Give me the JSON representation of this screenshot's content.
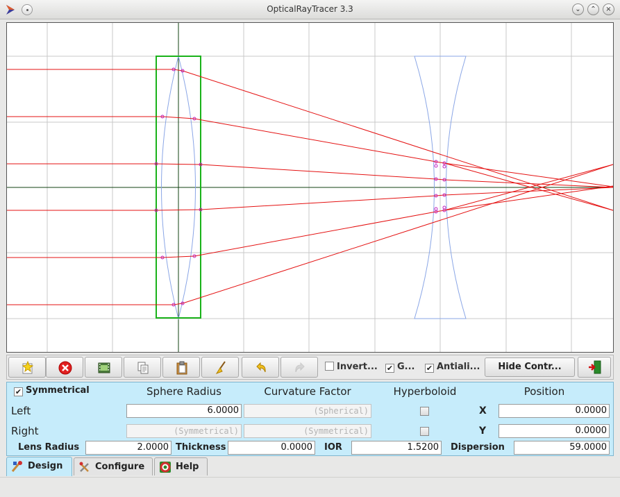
{
  "window": {
    "title": "OpticalRayTracer 3.3"
  },
  "toolbar": {
    "buttons": [
      {
        "name": "new-lens-button",
        "icon": "star-sparkle-icon"
      },
      {
        "name": "delete-lens-button",
        "icon": "red-x-icon"
      },
      {
        "name": "film-strip-button",
        "icon": "film-strip-icon"
      },
      {
        "name": "copy-button",
        "icon": "copy-icon"
      },
      {
        "name": "paste-button",
        "icon": "clipboard-icon"
      },
      {
        "name": "clean-button",
        "icon": "broom-icon"
      },
      {
        "name": "undo-button",
        "icon": "undo-arrow-icon"
      },
      {
        "name": "redo-button",
        "icon": "redo-arrow-icon",
        "disabled": true
      }
    ],
    "invert_label": "Invert...",
    "invert_checked": false,
    "grid_label": "G...",
    "grid_checked": true,
    "antialias_label": "Antiali...",
    "antialias_checked": true,
    "hide_controls_label": "Hide Contr...",
    "exit_icon": "exit-door-icon"
  },
  "controls": {
    "symmetrical_label": "Symmetrical",
    "symmetrical_checked": true,
    "headers": {
      "sphere_radius": "Sphere Radius",
      "curvature_factor": "Curvature Factor",
      "hyperboloid": "Hyperboloid",
      "position": "Position"
    },
    "left_label": "Left",
    "right_label": "Right",
    "left_sphere_radius": "6.0000",
    "left_curvature_placeholder": "(Spherical)",
    "right_sphere_radius_placeholder": "(Symmetrical)",
    "right_curvature_placeholder": "(Symmetrical)",
    "left_hyperboloid": false,
    "right_hyperboloid": false,
    "x_label": "X",
    "x_value": "0.0000",
    "y_label": "Y",
    "y_value": "0.0000",
    "lens_radius_label": "Lens Radius",
    "lens_radius_value": "2.0000",
    "thickness_label": "Thickness",
    "thickness_value": "0.0000",
    "ior_label": "IOR",
    "ior_value": "1.5200",
    "dispersion_label": "Dispersion",
    "dispersion_value": "59.0000"
  },
  "tabs": [
    {
      "label": "Design",
      "icon": "design-tools-icon",
      "active": true
    },
    {
      "label": "Configure",
      "icon": "configure-tools-icon",
      "active": false
    },
    {
      "label": "Help",
      "icon": "help-lifebuoy-icon",
      "active": false
    }
  ],
  "colors": {
    "ray": "#e41010",
    "lens_outline": "#8aa6e6",
    "selected_lens": "#19b219",
    "grid": "#c8c8c8",
    "axis": "#104010",
    "control_panel": "#c6ecfb"
  }
}
